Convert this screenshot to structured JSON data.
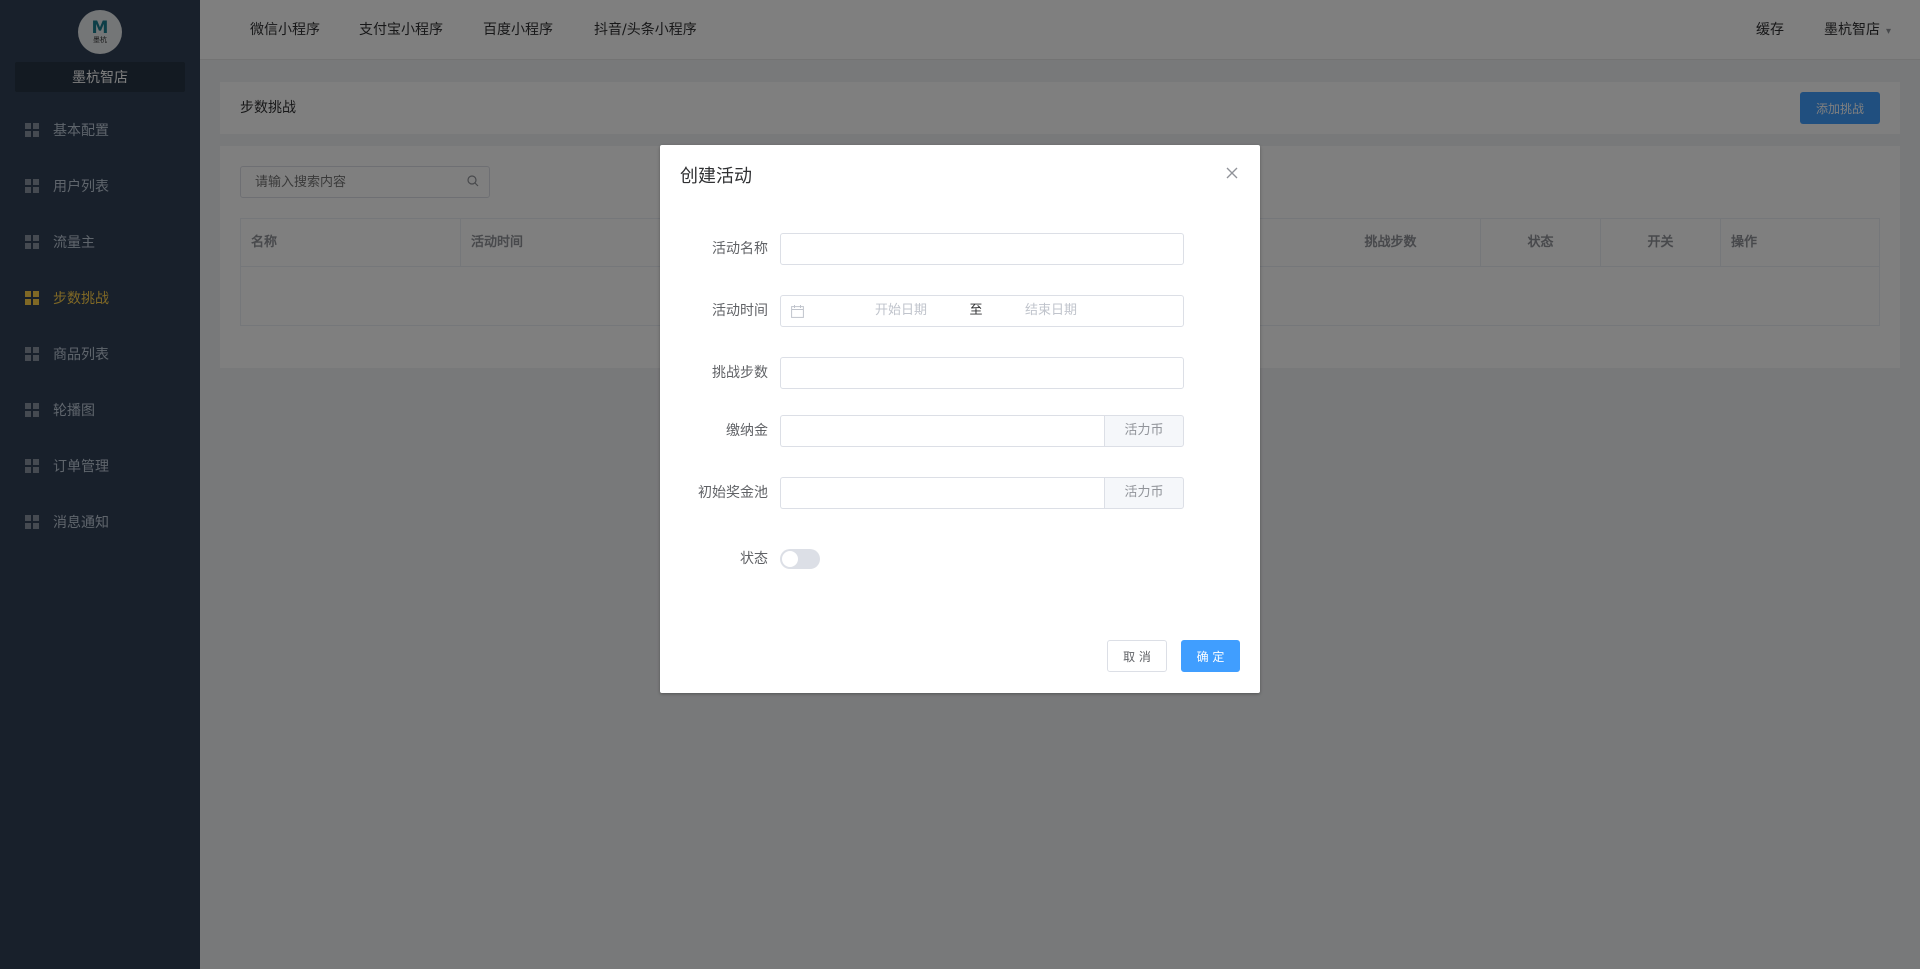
{
  "sidebar": {
    "logo": {
      "mark": "M",
      "text": "墨杭"
    },
    "shop_name": "墨杭智店",
    "items": [
      {
        "label": "基本配置",
        "active": false
      },
      {
        "label": "用户列表",
        "active": false
      },
      {
        "label": "流量主",
        "active": false
      },
      {
        "label": "步数挑战",
        "active": true
      },
      {
        "label": "商品列表",
        "active": false
      },
      {
        "label": "轮播图",
        "active": false
      },
      {
        "label": "订单管理",
        "active": false
      },
      {
        "label": "消息通知",
        "active": false
      }
    ]
  },
  "topbar": {
    "tabs": [
      "微信小程序",
      "支付宝小程序",
      "百度小程序",
      "抖音/头条小程序"
    ],
    "cache": "缓存",
    "user": "墨杭智店"
  },
  "page": {
    "title": "步数挑战",
    "add_button": "添加挑战",
    "search_placeholder": "请输入搜索内容",
    "table_headers": [
      "名称",
      "活动时间",
      "挑战步数",
      "状态",
      "开关",
      "操作"
    ]
  },
  "dialog": {
    "title": "创建活动",
    "fields": {
      "name_label": "活动名称",
      "time_label": "活动时间",
      "start_placeholder": "开始日期",
      "range_separator": "至",
      "end_placeholder": "结束日期",
      "steps_label": "挑战步数",
      "deposit_label": "缴纳金",
      "deposit_unit": "活力币",
      "pool_label": "初始奖金池",
      "pool_unit": "活力币",
      "status_label": "状态"
    },
    "status_on": false,
    "cancel": "取 消",
    "confirm": "确 定"
  },
  "colors": {
    "sidebar_bg": "#304156",
    "active": "#ffd04b",
    "primary": "#409eff"
  }
}
